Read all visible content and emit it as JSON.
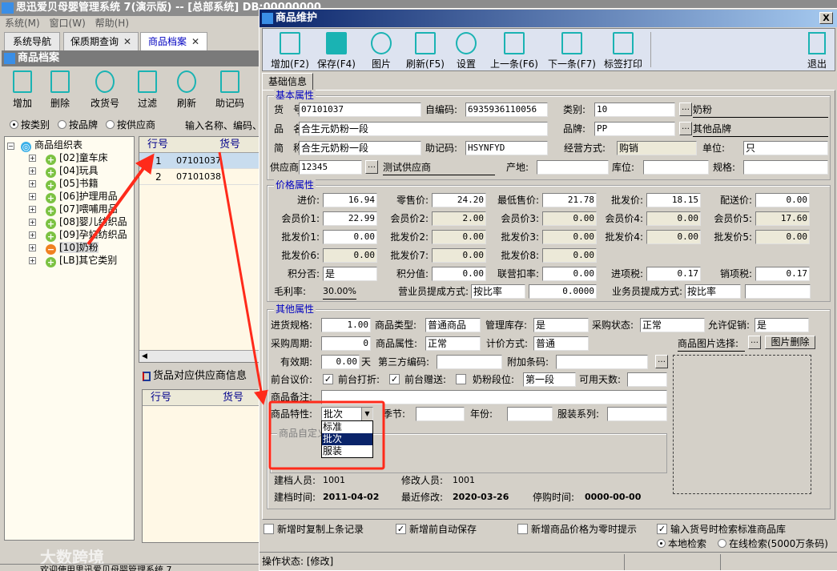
{
  "app": {
    "title": "思迅爱贝母婴管理系统 7(演示版) -- [总部系统] DB:00000000",
    "menu": [
      "系统(M)",
      "窗口(W)",
      "帮助(H)"
    ],
    "tabs": [
      {
        "label": "系统导航"
      },
      {
        "label": "保质期查询",
        "close": "✕"
      },
      {
        "label": "商品档案",
        "close": "✕"
      }
    ],
    "status": "欢迎使用思迅爱贝母婴管理系统 7",
    "watermark": "大数跨境"
  },
  "archive": {
    "title": "商品档案",
    "toolbar": [
      "增加",
      "删除",
      "改货号",
      "过滤",
      "刷新",
      "助记码"
    ],
    "filters": [
      {
        "label": "按类别",
        "selected": true
      },
      {
        "label": "按品牌",
        "selected": false
      },
      {
        "label": "按供应商",
        "selected": false
      }
    ],
    "search_hint": "输入名称、编码、",
    "tree": {
      "root": "商品组织表",
      "items": [
        "[02]童车床",
        "[04]玩具",
        "[05]书籍",
        "[06]护理用品",
        "[07]喂哺用品",
        "[08]婴儿纺织品",
        "[09]孕妇纺织品",
        "[10]奶粉",
        "[LB]其它类别"
      ],
      "selected": "[10]奶粉"
    },
    "grid": {
      "headers": [
        "行号",
        "货号"
      ],
      "rows": [
        [
          "1",
          "07101037"
        ],
        [
          "2",
          "07101038"
        ]
      ]
    },
    "supplier_panel": {
      "title": "货品对应供应商信息",
      "headers": [
        "行号",
        "货号"
      ]
    }
  },
  "dialog": {
    "title": "商品维护",
    "close": "X",
    "toolbar": [
      "增加(F2)",
      "保存(F4)",
      "图片",
      "刷新(F5)",
      "设置",
      "上一条(F6)",
      "下一条(F7)",
      "标签打印"
    ],
    "exit": "退出",
    "tab": "基础信息",
    "basic": {
      "title": "基本属性",
      "code_label": "货　号:",
      "code": "07101037",
      "selfcode_label": "自编码:",
      "selfcode": "6935936110056",
      "category_label": "类别:",
      "category": "10",
      "category_name": "奶粉",
      "name_label": "品　名:",
      "name": "合生元奶粉一段",
      "brand_label": "品牌:",
      "brand": "PP",
      "brand_name": "其他品牌",
      "short_label": "简　称:",
      "short": "合生元奶粉一段",
      "mnemonic_label": "助记码:",
      "mnemonic": "HSYNFYD",
      "mode_label": "经营方式:",
      "mode": "购销",
      "unit_label": "单位:",
      "unit": "只",
      "supplier_label": "供应商:",
      "supplier": "12345",
      "supplier_name": "测试供应商",
      "origin_label": "产地:",
      "origin": "",
      "location_label": "库位:",
      "location": "",
      "spec_label": "规格:",
      "spec": ""
    },
    "price": {
      "title": "价格属性",
      "rows": [
        [
          {
            "label": "进价:",
            "value": "16.94"
          },
          {
            "label": "零售价:",
            "value": "24.20"
          },
          {
            "label": "最低售价:",
            "value": "21.78"
          },
          {
            "label": "批发价:",
            "value": "18.15"
          },
          {
            "label": "配送价:",
            "value": "0.00"
          }
        ],
        [
          {
            "label": "会员价1:",
            "value": "22.99"
          },
          {
            "label": "会员价2:",
            "value": "2.00"
          },
          {
            "label": "会员价3:",
            "value": "0.00"
          },
          {
            "label": "会员价4:",
            "value": "0.00"
          },
          {
            "label": "会员价5:",
            "value": "17.60"
          }
        ],
        [
          {
            "label": "批发价1:",
            "value": "0.00"
          },
          {
            "label": "批发价2:",
            "value": "0.00"
          },
          {
            "label": "批发价3:",
            "value": "0.00"
          },
          {
            "label": "批发价4:",
            "value": "0.00"
          },
          {
            "label": "批发价5:",
            "value": "0.00"
          }
        ],
        [
          {
            "label": "批发价6:",
            "value": "0.00"
          },
          {
            "label": "批发价7:",
            "value": "0.00"
          },
          {
            "label": "批发价8:",
            "value": "0.00"
          }
        ],
        [
          {
            "label": "积分否:",
            "value": "是"
          },
          {
            "label": "积分值:",
            "value": "0.00"
          },
          {
            "label": "联营扣率:",
            "value": "0.00"
          },
          {
            "label": "进项税:",
            "value": "0.17"
          },
          {
            "label": "销项税:",
            "value": "0.17"
          }
        ]
      ],
      "margin_label": "毛利率:",
      "margin": "30.00%",
      "clerk_label": "营业员提成方式:",
      "clerk_mode": "按比率",
      "clerk_value": "0.0000",
      "sales_label": "业务员提成方式:",
      "sales_mode": "按比率",
      "sales_value": ""
    },
    "other": {
      "title": "其他属性",
      "purchase_spec_label": "进货规格:",
      "purchase_spec": "1.00",
      "type_label": "商品类型:",
      "type": "普通商品",
      "stock_label": "管理库存:",
      "stock": "是",
      "pstate_label": "采购状态:",
      "pstate": "正常",
      "promo_label": "允许促销:",
      "promo": "是",
      "cycle_label": "采购周期:",
      "cycle": "0",
      "attr_label": "商品属性:",
      "attr": "正常",
      "pricing_label": "计价方式:",
      "pricing": "普通",
      "image_label": "商品图片选择:",
      "image_delete": "图片删除",
      "valid_label": "有效期:",
      "valid": "0.00",
      "valid_unit": "天",
      "third_label": "第三方编码:",
      "third": "",
      "extra_label": "附加条码:",
      "extra": "",
      "bargain_label": "前台议价:",
      "bargain": true,
      "discount_label": "前台打折:",
      "discount": true,
      "gift_label": "前台赠送:",
      "gift": false,
      "stage_label": "奶粉段位:",
      "stage": "第一段",
      "days_label": "可用天数:",
      "days": "",
      "remark_label": "商品备注:",
      "remark": "",
      "feature_label": "商品特性:",
      "feature": "批次",
      "feature_options": [
        "标准",
        "批次",
        "服装"
      ],
      "season_label": "季节:",
      "season": "",
      "year_label": "年份:",
      "year": "",
      "series_label": "服装系列:",
      "series": "",
      "custom_title": "商品自定义",
      "creator_label": "建档人员:",
      "creator": "1001",
      "modifier_label": "修改人员:",
      "modifier": "1001",
      "created_label": "建档时间:",
      "created": "2011-04-02",
      "modified_label": "最近修改:",
      "modified": "2020-03-26",
      "stop_label": "停购时间:",
      "stop": "0000-00-00"
    },
    "options": [
      {
        "label": "新增时复制上条记录",
        "checked": false
      },
      {
        "label": "新增前自动保存",
        "checked": true
      },
      {
        "label": "新增商品价格为零时提示",
        "checked": false
      },
      {
        "label": "输入货号时检索标准商品库",
        "checked": true
      }
    ],
    "search_modes": [
      {
        "label": "本地检索",
        "selected": true
      },
      {
        "label": "在线检索(5000万条码)",
        "selected": false
      }
    ],
    "status": "操作状态: [修改]"
  },
  "colors": {
    "accent": "#1ab3b3",
    "highlight": "#0a246a",
    "annotation": "#ff2a1a"
  }
}
